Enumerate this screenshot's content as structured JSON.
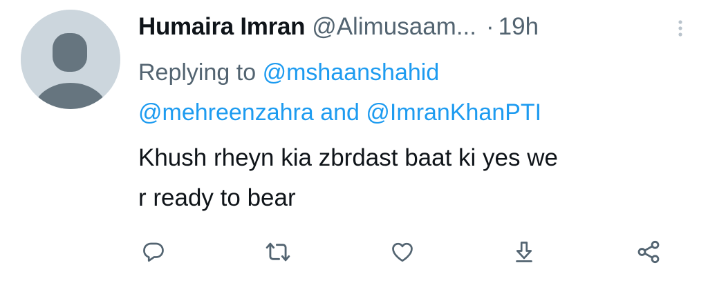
{
  "tweet": {
    "display_name": "Humaira Imran",
    "handle": "@Alimusaam...",
    "separator": "·",
    "time": "19h",
    "replying_prefix": "Replying to",
    "mention_1": "@mshaanshahid",
    "mention_2": "@mehreenzahra",
    "and_word": "and",
    "mention_3": "@ImranKhanPTI",
    "text_line_1": "Khush rheyn kia zbrdast baat ki yes we",
    "text_line_2": "r ready to bear"
  },
  "icons": {
    "avatar": "default-avatar-icon",
    "more": "more-vertical-icon",
    "reply": "reply-icon",
    "retweet": "retweet-icon",
    "like": "heart-icon",
    "download": "download-icon",
    "share": "share-icon"
  },
  "colors": {
    "text": "#0f1419",
    "secondary": "#536471",
    "link": "#1d9bf0",
    "avatar_bg": "#ccd6dd",
    "avatar_fg": "#66757f"
  }
}
